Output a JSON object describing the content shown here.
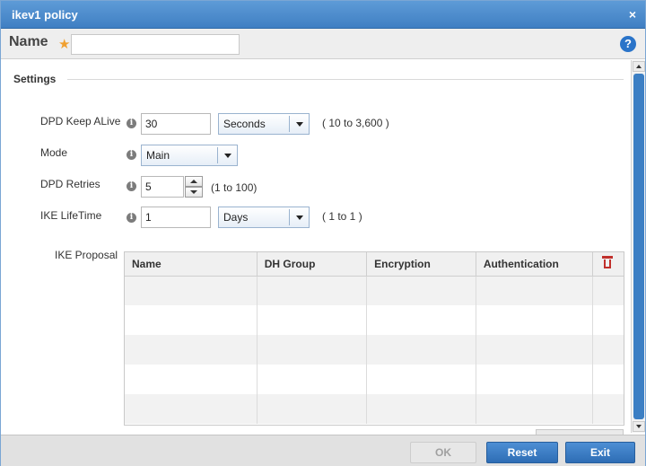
{
  "window": {
    "title": "ikev1 policy",
    "close_glyph": "×"
  },
  "name_field": {
    "label": "Name",
    "required_marker": "★",
    "value": "",
    "help_glyph": "?"
  },
  "settings": {
    "title": "Settings",
    "dpd_keep_alive": {
      "label": "DPD Keep ALive",
      "value": "30",
      "unit": "Seconds",
      "range": "( 10 to 3,600 )"
    },
    "mode": {
      "label": "Mode",
      "value": "Main"
    },
    "dpd_retries": {
      "label": "DPD Retries",
      "value": "5",
      "range": "(1 to 100)"
    },
    "ike_lifetime": {
      "label": "IKE LifeTime",
      "value": "1",
      "unit": "Days",
      "range": "( 1 to 1 )"
    },
    "ike_proposal": {
      "label": "IKE Proposal",
      "columns": [
        "Name",
        "DH Group",
        "Encryption",
        "Authentication"
      ],
      "rows": []
    }
  },
  "info_glyph": "i",
  "footer": {
    "ok_label": "OK",
    "reset_label": "Reset",
    "exit_label": "Exit"
  },
  "colors": {
    "title_bar": "#4a8ccf",
    "accent_button": "#3a7bc4",
    "required_star": "#f0a030",
    "trash": "#c0302c"
  }
}
